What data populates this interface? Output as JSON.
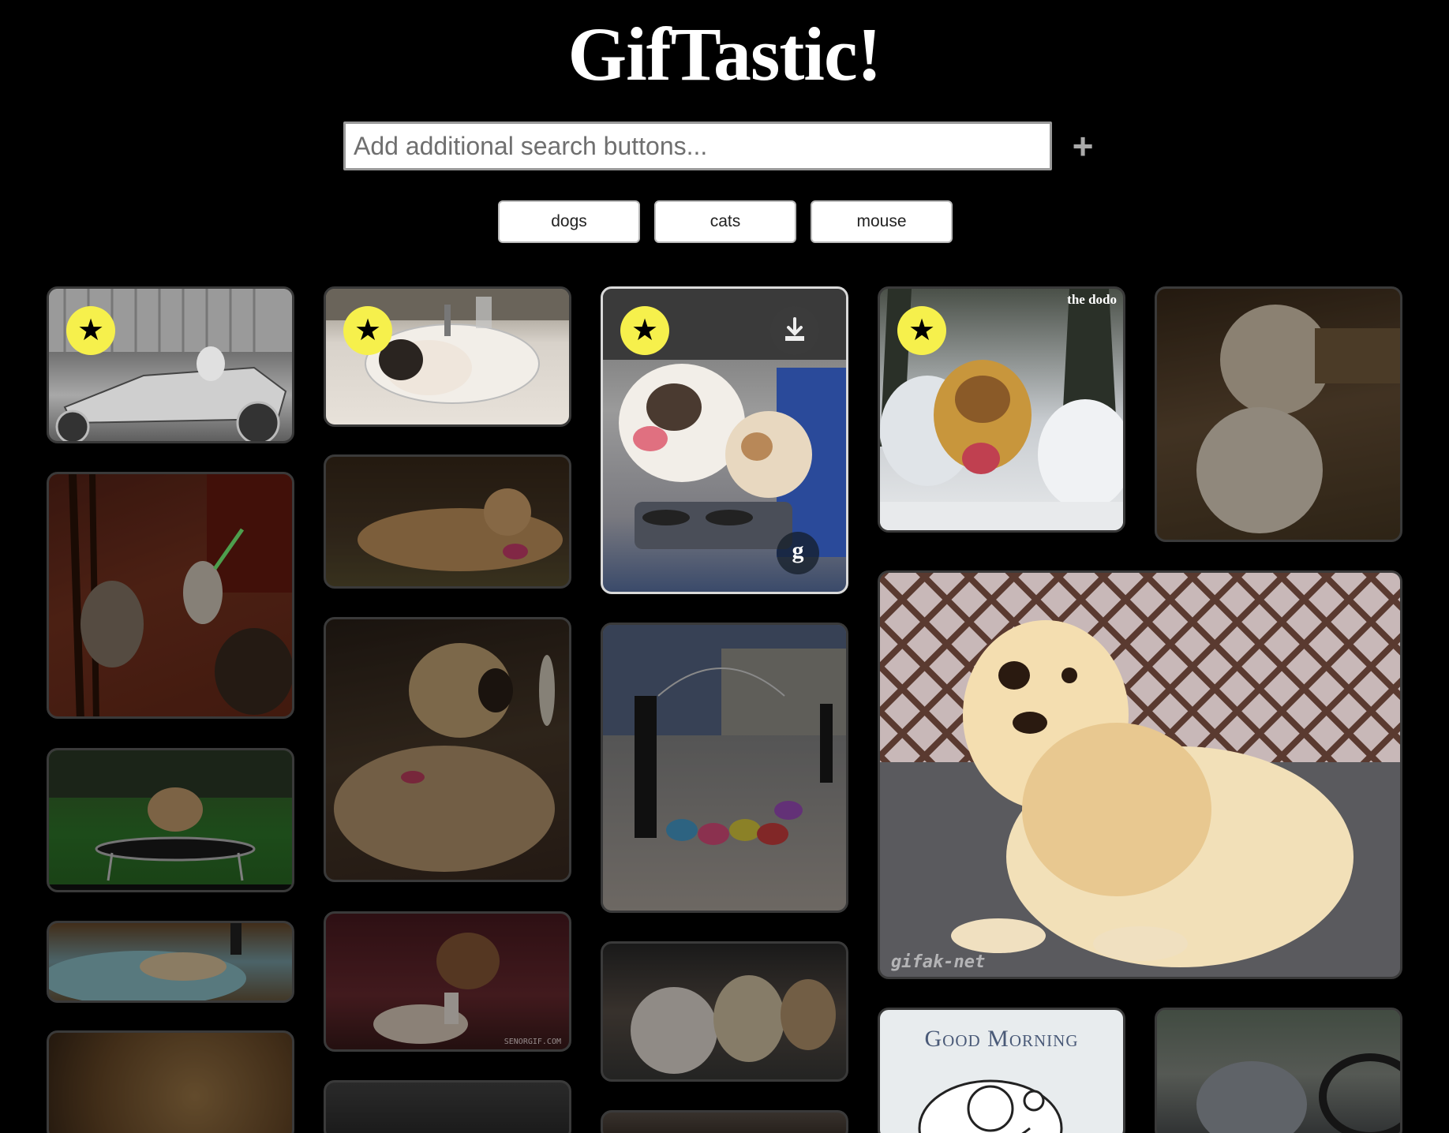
{
  "header": {
    "title": "GifTastic!"
  },
  "search": {
    "placeholder": "Add additional search buttons...",
    "add_label": "+"
  },
  "topics": [
    "dogs",
    "cats",
    "mouse"
  ],
  "gifs": {
    "watermark_gifak": "gifak-net",
    "watermark_good_morning": "Good Morning",
    "watermark_dodo": "the dodo",
    "watermark_senorgif": "SENORGIF.COM",
    "g_label": "g"
  },
  "icons": {
    "favorite": "star-icon",
    "download": "download-icon",
    "giphy": "giphy-icon",
    "add": "plus-icon"
  },
  "colors": {
    "background": "#000000",
    "favorite_badge": "#f6f04c",
    "card_border": "#3a3a3a",
    "card_border_active": "#d9d9d9"
  }
}
